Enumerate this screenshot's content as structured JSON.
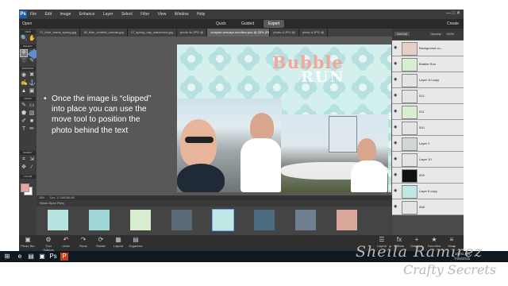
{
  "app": {
    "logo": "Ps",
    "menu": [
      "File",
      "Edit",
      "Image",
      "Enhance",
      "Layer",
      "Select",
      "Filter",
      "View",
      "Window",
      "Help"
    ],
    "window_controls": [
      "—",
      "□",
      "✕"
    ]
  },
  "modebar": {
    "open": "Open",
    "modes": [
      "Quick",
      "Guided",
      "Expert"
    ],
    "active_mode": "Expert",
    "create": "Create"
  },
  "tabs": [
    "17_blue_swirls_spring.jpg",
    "18_blue_confetti_canvas.jpg",
    "17_spring_day_watercolor.jpg",
    "photo 4c.JPG @",
    "bnnysbr-wmcapr-scrollsm.psd @ 25% (RGB/8)",
    "photo 4.JPG @",
    "photo 4.JPG @"
  ],
  "active_tab_index": 4,
  "toolbar": {
    "sections": [
      "VIEW",
      "SELECT",
      "ENHANCE",
      "DRAW",
      "MODIFY",
      "COLOR"
    ],
    "foreground_color": "#f0a2a0",
    "background_color": "#ffffff"
  },
  "callout": {
    "bullet": "•",
    "text": "Once the image is “clipped” into place you can use the move tool to position the photo behind the text"
  },
  "artwork": {
    "title_line1": "Bubble",
    "title_line2": "RUN"
  },
  "status": {
    "zoom": "25%",
    "doc": "Doc: 17.1M/168.4M"
  },
  "photo_bin": {
    "label": "Show Open Files"
  },
  "layers_panel": {
    "blend_mode": "Normal",
    "opacity_label": "Opacity:",
    "opacity_value": "100%",
    "layers": [
      {
        "name": "Background co...",
        "thumb": "#e6cfc6"
      },
      {
        "name": "Bubble Run",
        "thumb": "#d6efd0"
      },
      {
        "name": "Layer 10 copy",
        "thumb": "#e4e4e4"
      },
      {
        "name": "012",
        "thumb": "#e4e4e4"
      },
      {
        "name": "011",
        "thumb": "#d6efd0"
      },
      {
        "name": "010",
        "thumb": "#e4e4e4"
      },
      {
        "name": "Layer 2",
        "thumb": "#d0d8d8"
      },
      {
        "name": "Layer 10",
        "thumb": "#e4e4e4"
      },
      {
        "name": "009",
        "thumb": "#111111"
      },
      {
        "name": "Layer 8 copy",
        "thumb": "#bfe7e3"
      },
      {
        "name": "008",
        "thumb": "#e4e4e4"
      }
    ]
  },
  "bottom_buttons": {
    "left": [
      "Photo Bin",
      "Tool Options",
      "Undo",
      "Redo",
      "Rotate",
      "Layout",
      "Organizer"
    ],
    "right": [
      "Layers",
      "Effects",
      "Graphics",
      "Favorites",
      "More"
    ]
  },
  "clock": {
    "time": "10:01 AM",
    "date": "7/26/2015"
  },
  "watermark": {
    "line1": "Sheila Ramirez",
    "line2": "Crafty Secrets"
  },
  "colors": {
    "accent_arrow": "#5b8fd0",
    "title_pink": "#f2a79a"
  }
}
